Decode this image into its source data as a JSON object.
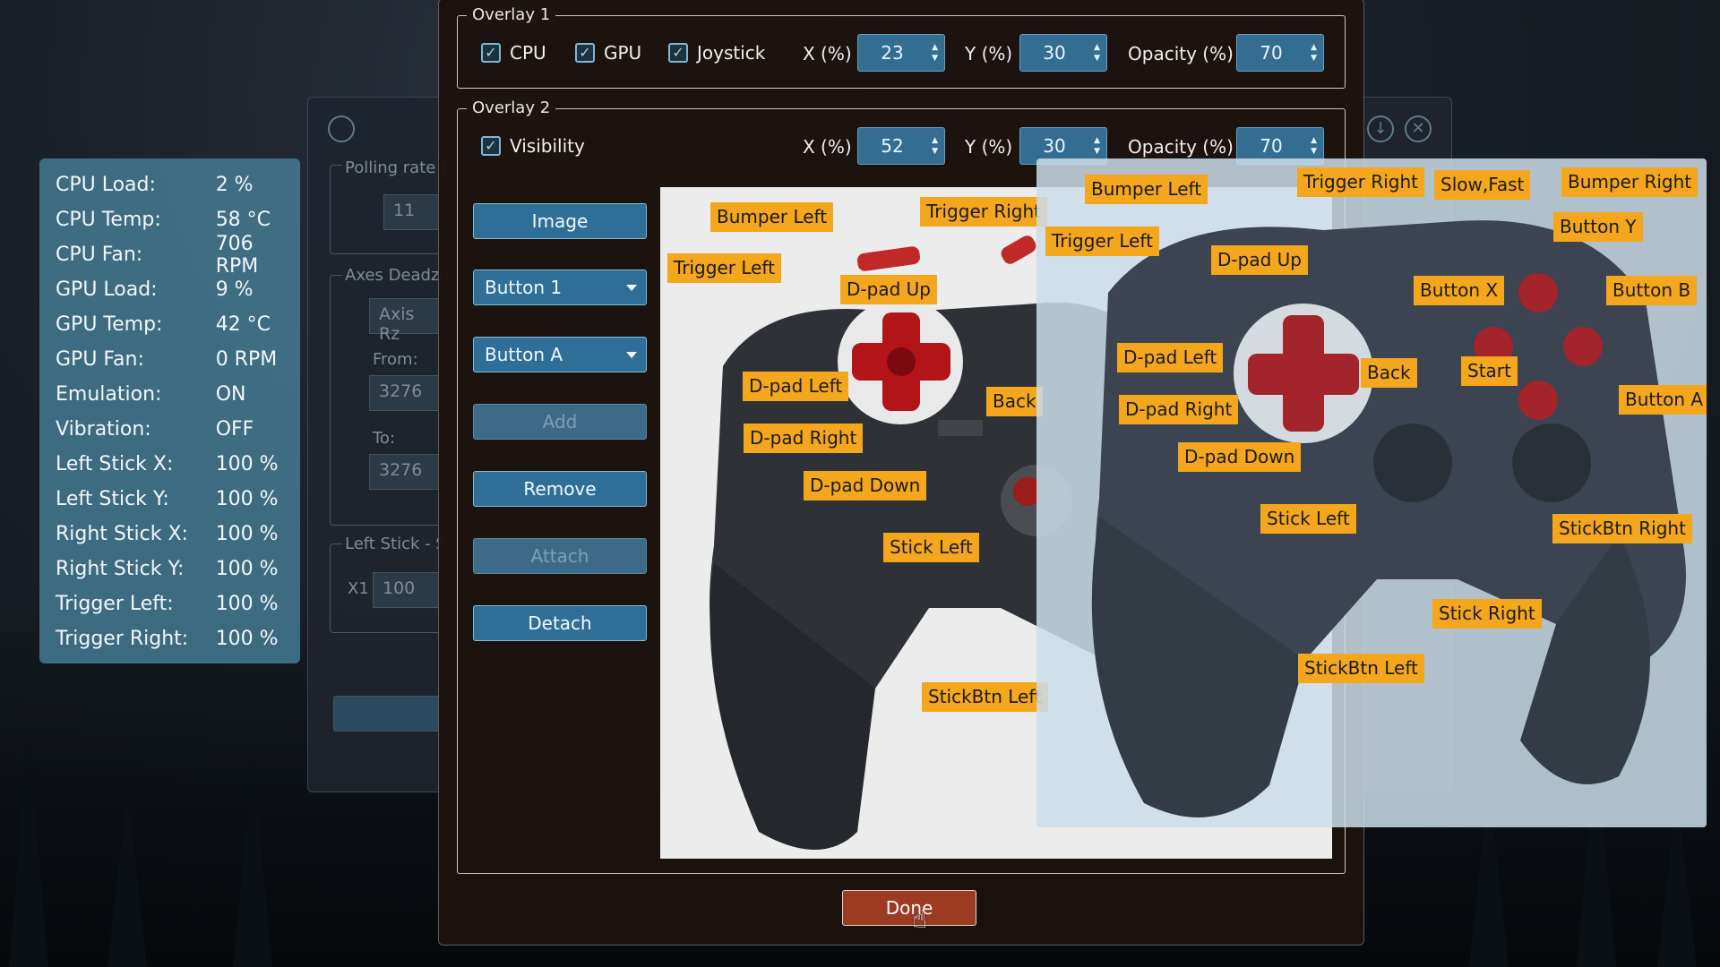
{
  "stats": [
    {
      "label": "CPU Load:",
      "value": "2 %"
    },
    {
      "label": "CPU Temp:",
      "value": "58 °C"
    },
    {
      "label": "CPU Fan:",
      "value": "706 RPM"
    },
    {
      "label": "GPU Load:",
      "value": "9 %"
    },
    {
      "label": "GPU Temp:",
      "value": "42 °C"
    },
    {
      "label": "GPU Fan:",
      "value": "0 RPM"
    },
    {
      "label": "Emulation:",
      "value": "ON"
    },
    {
      "label": "Vibration:",
      "value": "OFF"
    },
    {
      "label": "Left Stick X:",
      "value": "100 %"
    },
    {
      "label": "Left Stick Y:",
      "value": "100 %"
    },
    {
      "label": "Right Stick X:",
      "value": "100 %"
    },
    {
      "label": "Right Stick Y:",
      "value": "100 %"
    },
    {
      "label": "Trigger Left:",
      "value": "100 %"
    },
    {
      "label": "Trigger Right:",
      "value": "100 %"
    }
  ],
  "background_window": {
    "polling_label": "Polling rate (",
    "polling_value": "11",
    "axes_label": "Axes Deadzo",
    "axis_value": "Axis Rz",
    "from_label": "From:",
    "from_value": "3276",
    "to_label": "To:",
    "to_value": "3276",
    "leftstick_label": "Left Stick - S",
    "x1_label": "X1",
    "x1_value": "100"
  },
  "overlay1": {
    "title": "Overlay 1",
    "cpu_label": "CPU",
    "gpu_label": "GPU",
    "joystick_label": "Joystick",
    "x_label": "X (%)",
    "x_value": "23",
    "y_label": "Y (%)",
    "y_value": "30",
    "opacity_label": "Opacity (%)",
    "opacity_value": "70"
  },
  "overlay2": {
    "title": "Overlay 2",
    "visibility_label": "Visibility",
    "x_label": "X (%)",
    "x_value": "52",
    "y_label": "Y (%)",
    "y_value": "30",
    "opacity_label": "Opacity (%)",
    "opacity_value": "70"
  },
  "side_buttons": {
    "image": "Image",
    "button_select": "Button 1",
    "mapping_select": "Button A",
    "add": "Add",
    "remove": "Remove",
    "attach": "Attach",
    "detach": "Detach"
  },
  "editor_tags": {
    "bumper_left": "Bumper Left",
    "trigger_right": "Trigger Right",
    "trigger_left": "Trigger Left",
    "dpad_up": "D-pad Up",
    "dpad_left": "D-pad Left",
    "back": "Back",
    "dpad_right": "D-pad Right",
    "dpad_down": "D-pad Down",
    "stick_left": "Stick Left",
    "stickbtn_left": "StickBtn Left"
  },
  "overlay_tags": {
    "bumper_left": "Bumper Left",
    "trigger_right": "Trigger Right",
    "slow_fast": "Slow,Fast",
    "bumper_right": "Bumper Right",
    "trigger_left": "Trigger Left",
    "dpad_up": "D-pad Up",
    "button_y": "Button Y",
    "button_x": "Button X",
    "button_b": "Button B",
    "dpad_left": "D-pad Left",
    "back": "Back",
    "start": "Start",
    "dpad_right": "D-pad Right",
    "button_a": "Button A",
    "dpad_down": "D-pad Down",
    "stick_left": "Stick Left",
    "stickbtn_right": "StickBtn Right",
    "stick_right": "Stick Right",
    "stickbtn_left": "StickBtn Left"
  },
  "done_label": "Done",
  "colors": {
    "tag_bg": "#f4a61c",
    "accent_blue": "#2f6f97",
    "done_red": "#9c3a22",
    "stats_bg": "#48829c"
  }
}
